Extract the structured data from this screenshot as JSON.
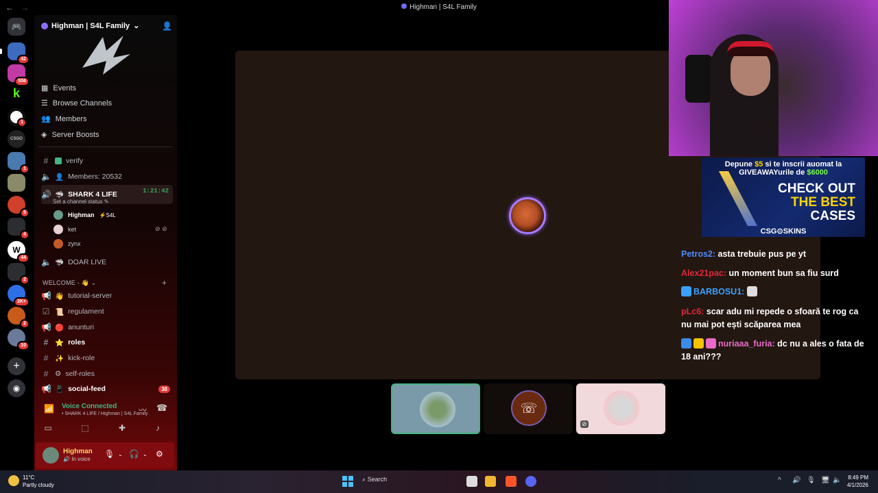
{
  "window": {
    "title": "Highman | S4L Family",
    "nav_back": "←",
    "nav_fwd": "→"
  },
  "server": {
    "name": "Highman | S4L Family"
  },
  "rail_badges": [
    "42",
    "556",
    "1",
    "1",
    "5",
    "4",
    "44",
    "2",
    "2K+",
    "2",
    "10"
  ],
  "menu": [
    {
      "label": "Events",
      "icon": "calendar-icon"
    },
    {
      "label": "Browse Channels",
      "icon": "browse-icon"
    },
    {
      "label": "Members",
      "icon": "members-icon"
    },
    {
      "label": "Server Boosts",
      "icon": "boost-icon"
    }
  ],
  "channels": {
    "verify": "verify",
    "members_count": "Members: 20532",
    "voice_active": {
      "name": "SHARK 4 LIFE",
      "timer": "1:21:42",
      "status": "Set a channel status"
    },
    "voice_members": [
      {
        "name": "Highman",
        "tag": "S4L"
      },
      {
        "name": "ket"
      },
      {
        "name": "zynx"
      }
    ],
    "doar_live": "DOAR LIVE",
    "category_welcome": "WELCOME - 👋",
    "list": [
      {
        "name": "tutorial-server",
        "emoji": "👋"
      },
      {
        "name": "regulament",
        "emoji": "📜"
      },
      {
        "name": "anunturi",
        "emoji": "🔴"
      },
      {
        "name": "roles",
        "emoji": "⭐"
      },
      {
        "name": "kick-role",
        "emoji": "✨"
      },
      {
        "name": "self-roles",
        "emoji": "⚙"
      },
      {
        "name": "social-feed",
        "emoji": "📱",
        "mentions": "38"
      }
    ]
  },
  "voice_panel": {
    "title": "Voice Connected",
    "subtitle": "SHARK 4 LIFE / Highman | S4L Family"
  },
  "user": {
    "name": "Highman",
    "status": "In voice"
  },
  "ad": {
    "line1_a": "Depune ",
    "line1_b": "$5",
    "line1_c": " si te inscrii auomat la",
    "line2_a": "GIVEAWAYurile de ",
    "line2_b": "$6000",
    "big1": "CHECK OUT",
    "big2": "THE BEST",
    "big3": "CASES",
    "logo": "CSG⊙SKINS"
  },
  "chat": [
    {
      "user": "Petros2:",
      "color": "#4a8cff",
      "text": "asta trebuie pus pe yt"
    },
    {
      "user": "Alex21pac:",
      "color": "#e0283a",
      "text": "un moment bun sa fiu surd"
    },
    {
      "user": "BARBOSU1:",
      "color": "#3aa0ff",
      "text": ""
    },
    {
      "user": "pLc6:",
      "color": "#e02838",
      "text": "scar adu mi repede o sfoară te rog ca nu mai pot ești scăparea mea"
    },
    {
      "user": "nuriaaa_furia:",
      "color": "#e86ac8",
      "text": "dc nu a ales o fata de 18 ani???"
    }
  ],
  "taskbar": {
    "temp": "11°C",
    "weather": "Partly cloudy",
    "search": "Search",
    "time": "8:49 PM",
    "date": "4/1/2026"
  },
  "colors": {
    "voice_green": "#43b581",
    "userbar": "#800c10",
    "stage": "#231711"
  }
}
